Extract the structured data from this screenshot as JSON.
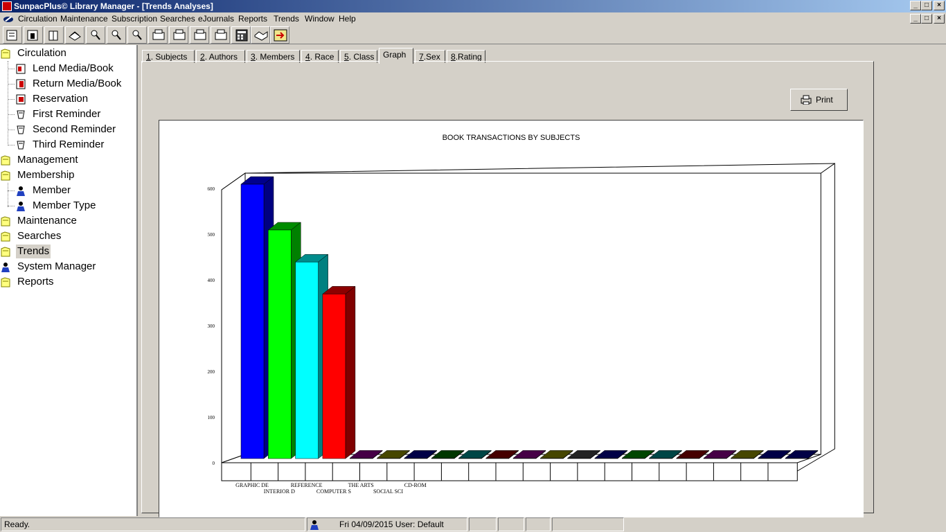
{
  "window": {
    "title": "SunpacPlus© Library Manager - [Trends Analyses]"
  },
  "menu": [
    "Circulation",
    "Maintenance",
    "Subscription",
    "Searches",
    "eJournals",
    "Reports",
    "Trends",
    "Window",
    "Help"
  ],
  "toolbar": {
    "icons": [
      "lend-book-icon",
      "return-book-icon",
      "reservation-icon",
      "books-icon",
      "search-icon",
      "search-icon-2",
      "search-icon-3",
      "printer-report-icon-1",
      "printer-report-icon-2",
      "printer-report-icon-3",
      "printer-report-icon-4",
      "calculator-icon",
      "handshake-icon",
      "exit-icon"
    ]
  },
  "sidebar": {
    "items": [
      {
        "label": "Circulation",
        "icon": "folder-icon",
        "level": 0
      },
      {
        "label": "Lend Media/Book",
        "icon": "lend-book-icon",
        "level": 1
      },
      {
        "label": "Return Media/Book",
        "icon": "return-book-icon",
        "level": 1
      },
      {
        "label": "Reservation",
        "icon": "reservation-icon",
        "level": 1
      },
      {
        "label": "First Reminder",
        "icon": "reminder-icon",
        "level": 1
      },
      {
        "label": "Second Reminder",
        "icon": "reminder-icon",
        "level": 1
      },
      {
        "label": "Third Reminder",
        "icon": "reminder-icon",
        "level": 1
      },
      {
        "label": "Management",
        "icon": "folder-icon",
        "level": 0
      },
      {
        "label": "Membership",
        "icon": "folder-icon",
        "level": 0
      },
      {
        "label": "Member",
        "icon": "person-icon",
        "level": 1
      },
      {
        "label": "Member Type",
        "icon": "person-icon",
        "level": 1
      },
      {
        "label": "Maintenance",
        "icon": "folder-icon",
        "level": 0
      },
      {
        "label": "Searches",
        "icon": "folder-icon",
        "level": 0
      },
      {
        "label": "Trends",
        "icon": "folder-icon",
        "level": 0,
        "selected": true
      },
      {
        "label": "System Manager",
        "icon": "person-icon",
        "level": 0
      },
      {
        "label": "Reports",
        "icon": "folder-icon",
        "level": 0
      }
    ]
  },
  "tabs": [
    {
      "key": "1",
      "label": ". Subjects"
    },
    {
      "key": "2",
      "label": ". Authors"
    },
    {
      "key": "3",
      "label": ". Members"
    },
    {
      "key": "4",
      "label": ". Race"
    },
    {
      "key": "5",
      "label": ". Class"
    },
    {
      "key": "",
      "label": "Graph",
      "active": true
    },
    {
      "key": "7",
      "label": ".Sex"
    },
    {
      "key": "8",
      "label": ".Rating"
    }
  ],
  "print_button": {
    "label": "Print"
  },
  "chart_data": {
    "type": "bar",
    "title": "BOOK TRANSACTIONS BY SUBJECTS",
    "xlabel": "",
    "ylabel": "",
    "ylim": [
      0,
      600
    ],
    "yticks": [
      "600",
      "500",
      "400",
      "300",
      "200",
      "100",
      "0"
    ],
    "categories": [
      "GRAPHIC DE",
      "INTERIOR D",
      "REFERENCE",
      "COMPUTER S",
      "THE ARTS",
      "SOCIAL SCI",
      "CD-ROM",
      "",
      "",
      "",
      "",
      "",
      "",
      "",
      "",
      "",
      "",
      "",
      "",
      "",
      ""
    ],
    "values": [
      600,
      500,
      430,
      360,
      1,
      1,
      1,
      1,
      1,
      1,
      1,
      1,
      1,
      1,
      1,
      1,
      1,
      1,
      1,
      1,
      1
    ],
    "colors": [
      "#0000ff",
      "#00ff00",
      "#00ffff",
      "#ff0000",
      "#800080",
      "#808000",
      "#000080",
      "#006400",
      "#008080",
      "#800000",
      "#800080",
      "#808000",
      "#404040",
      "#000080",
      "#008000",
      "#008080",
      "#800000",
      "#800080",
      "#808000",
      "#000080",
      "#000080"
    ]
  },
  "status": {
    "ready": "Ready.",
    "datetime_user": "Fri 04/09/2015 User: Default"
  }
}
